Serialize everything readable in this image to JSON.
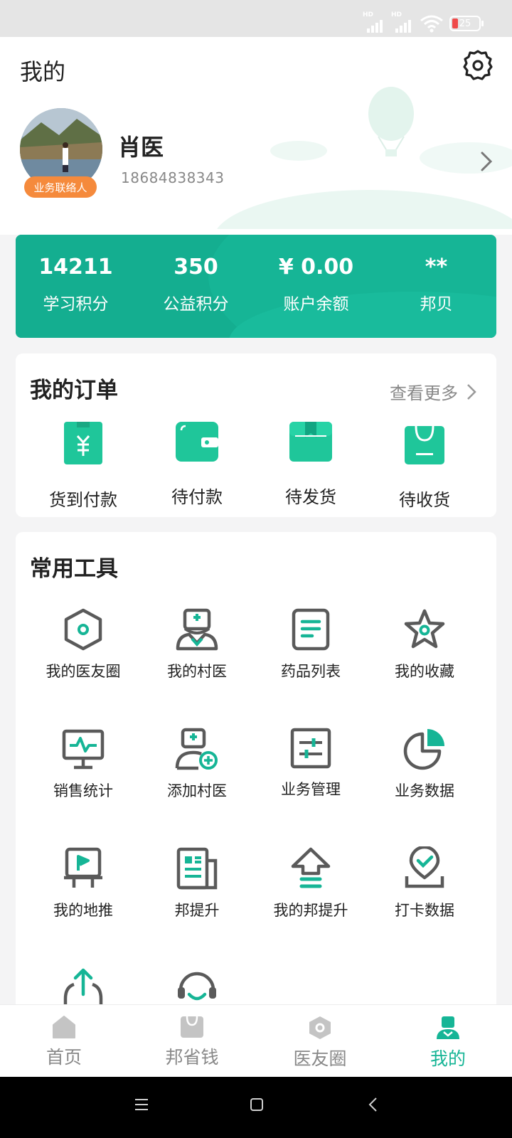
{
  "status_bar": {
    "signal_1_label": "HD",
    "signal_2_label": "HD",
    "battery_level": "25"
  },
  "header": {
    "title": "我的",
    "settings_icon": "gear-icon"
  },
  "profile": {
    "name": "肖医",
    "phone": "18684838343",
    "role_badge": "业务联络人",
    "chevron_icon": "chevron-right-icon"
  },
  "stats": [
    {
      "value": "14211",
      "label": "学习积分"
    },
    {
      "value": "350",
      "label": "公益积分"
    },
    {
      "value": "¥ 0.00",
      "label": "账户余额"
    },
    {
      "value": "**",
      "label": "邦贝"
    }
  ],
  "orders": {
    "title": "我的订单",
    "more_label": "查看更多",
    "items": [
      {
        "label": "货到付款",
        "icon": "cash-on-delivery-icon"
      },
      {
        "label": "待付款",
        "icon": "wallet-icon"
      },
      {
        "label": "待发货",
        "icon": "box-icon"
      },
      {
        "label": "待收货",
        "icon": "shopping-bag-icon"
      }
    ]
  },
  "tools": {
    "title": "常用工具",
    "items": [
      {
        "label": "我的医友圈",
        "icon": "hexagon-icon"
      },
      {
        "label": "我的村医",
        "icon": "doctor-icon"
      },
      {
        "label": "药品列表",
        "icon": "document-list-icon"
      },
      {
        "label": "我的收藏",
        "icon": "star-icon"
      },
      {
        "label": "销售统计",
        "icon": "monitor-chart-icon"
      },
      {
        "label": "添加村医",
        "icon": "add-doctor-icon"
      },
      {
        "label": "业务管理",
        "icon": "sliders-icon"
      },
      {
        "label": "业务数据",
        "icon": "pie-chart-icon"
      },
      {
        "label": "我的地推",
        "icon": "billboard-flag-icon"
      },
      {
        "label": "邦提升",
        "icon": "newspaper-icon"
      },
      {
        "label": "我的邦提升",
        "icon": "upload-arrow-icon"
      },
      {
        "label": "打卡数据",
        "icon": "checkin-pin-icon"
      },
      {
        "label": "",
        "icon": "share-icon"
      },
      {
        "label": "",
        "icon": "headset-icon"
      }
    ]
  },
  "bottom_nav": [
    {
      "label": "首页",
      "icon": "home-icon",
      "active": false
    },
    {
      "label": "邦省钱",
      "icon": "bag-icon",
      "active": false
    },
    {
      "label": "医友圈",
      "icon": "hexagon-icon",
      "active": false
    },
    {
      "label": "我的",
      "icon": "person-icon",
      "active": true
    }
  ],
  "colors": {
    "accent": "#16b596",
    "badge": "#f58a3c",
    "icon_gray": "#5a5a5a",
    "inactive": "#888888"
  }
}
